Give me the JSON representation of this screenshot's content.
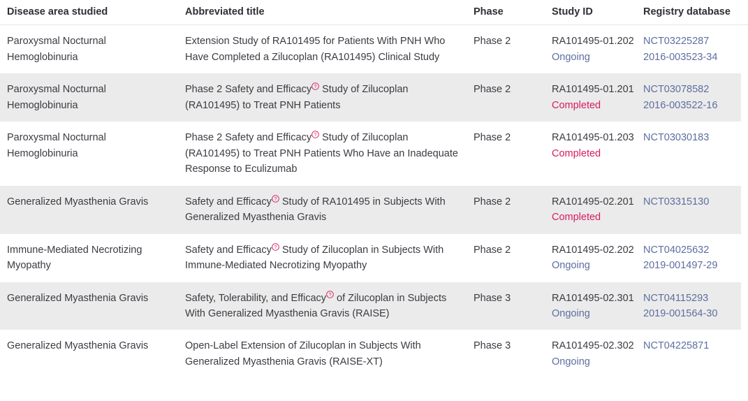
{
  "table": {
    "columns": [
      {
        "key": "disease",
        "label": "Disease area studied"
      },
      {
        "key": "title",
        "label": "Abbreviated title"
      },
      {
        "key": "phase",
        "label": "Phase"
      },
      {
        "key": "study_id",
        "label": "Study ID"
      },
      {
        "key": "registry",
        "label": "Registry database"
      }
    ],
    "colors": {
      "text": "#3b3b43",
      "header_text": "#2f2f36",
      "stripe": "#ebebeb",
      "link": "#5d6fa0",
      "status_ongoing": "#5d6fa0",
      "status_completed": "#d81b60",
      "help_icon": "#d81b60",
      "border": "#e6e6e6"
    },
    "help_icon_name": "question-circle-icon",
    "rows": [
      {
        "disease": "Paroxysmal Nocturnal Hemoglobinuria",
        "title_before": "Extension Study of RA101495 for Patients With PNH Who Have Completed a Zilucoplan (RA101495) Clinical Study",
        "title_after": "",
        "has_help": false,
        "phase": "Phase 2",
        "study_code": "RA101495-01.202",
        "status": "Ongoing",
        "status_type": "ongoing",
        "registry": [
          "NCT03225287",
          "2016-003523-34"
        ],
        "striped": false
      },
      {
        "disease": "Paroxysmal Nocturnal Hemoglobinuria",
        "title_before": "Phase 2 Safety and Efficacy",
        "title_after": " Study of Zilucoplan (RA101495) to Treat PNH Patients",
        "has_help": true,
        "phase": "Phase 2",
        "study_code": "RA101495-01.201",
        "status": "Completed",
        "status_type": "completed",
        "registry": [
          "NCT03078582",
          "2016-003522-16"
        ],
        "striped": true
      },
      {
        "disease": "Paroxysmal Nocturnal Hemoglobinuria",
        "title_before": "Phase 2 Safety and Efficacy",
        "title_after": " Study of Zilucoplan (RA101495) to Treat PNH Patients Who Have an Inadequate Response to Eculizumab",
        "has_help": true,
        "phase": "Phase 2",
        "study_code": "RA101495-01.203",
        "status": "Completed",
        "status_type": "completed",
        "registry": [
          "NCT03030183"
        ],
        "striped": false
      },
      {
        "disease": "Generalized Myasthenia Gravis",
        "title_before": "Safety and Efficacy",
        "title_after": " Study of RA101495 in Subjects With Generalized Myasthenia Gravis",
        "has_help": true,
        "phase": "Phase 2",
        "study_code": "RA101495-02.201",
        "status": "Completed",
        "status_type": "completed",
        "registry": [
          "NCT03315130"
        ],
        "striped": true
      },
      {
        "disease": "Immune-Mediated Necrotizing Myopathy",
        "title_before": "Safety and Efficacy",
        "title_after": " Study of Zilucoplan in Subjects With Immune-Mediated Necrotizing Myopathy",
        "has_help": true,
        "phase": "Phase 2",
        "study_code": "RA101495-02.202",
        "status": "Ongoing",
        "status_type": "ongoing",
        "registry": [
          "NCT04025632",
          "2019-001497-29"
        ],
        "striped": false
      },
      {
        "disease": "Generalized Myasthenia Gravis",
        "title_before": "Safety, Tolerability, and Efficacy",
        "title_after": " of Zilucoplan in Subjects With Generalized Myasthenia Gravis (RAISE)",
        "has_help": true,
        "phase": "Phase 3",
        "study_code": "RA101495-02.301",
        "status": "Ongoing",
        "status_type": "ongoing",
        "registry": [
          "NCT04115293",
          "2019-001564-30"
        ],
        "striped": true
      },
      {
        "disease": "Generalized Myasthenia Gravis",
        "title_before": "Open-Label Extension of Zilucoplan in Subjects With Generalized Myasthenia Gravis (RAISE-XT)",
        "title_after": "",
        "has_help": false,
        "phase": "Phase 3",
        "study_code": " RA101495-02.302",
        "status": "Ongoing",
        "status_type": "ongoing",
        "registry": [
          "NCT04225871"
        ],
        "striped": false
      }
    ]
  }
}
